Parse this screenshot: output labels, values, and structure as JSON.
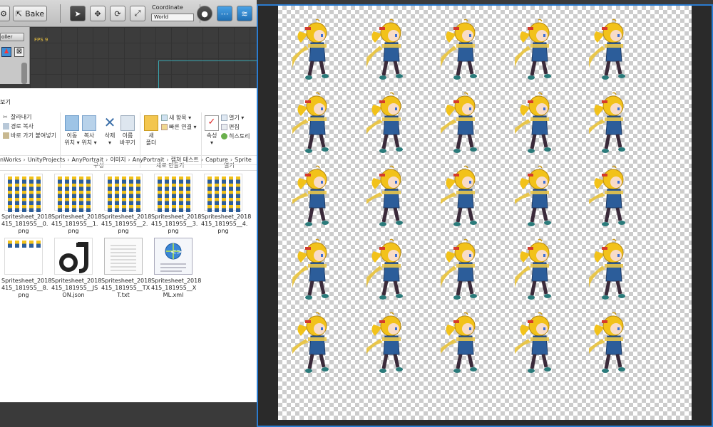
{
  "toolbar": {
    "bake_label": "Bake",
    "coordinate_label": "Coordinate",
    "coordinate_value": "World"
  },
  "left_panel": {
    "controller_label": "oller"
  },
  "viewport": {
    "fps_label": "FPS 9"
  },
  "explorer": {
    "title_fragment": "보기",
    "ribbon": {
      "cut": "잘라내기",
      "copy_path": "경로 복사",
      "paste_shortcut": "바로 가기 붙여넣기",
      "move_to": "이동\n위치 ▾",
      "copy_to": "복사\n위치 ▾",
      "delete": "삭제\n▾",
      "rename": "이름\n바꾸기",
      "new_folder": "새\n폴더",
      "new_item": "새 항목 ▾",
      "easy_access": "빠른 연결 ▾",
      "properties": "속성\n▾",
      "open": "열기 ▾",
      "edit": "편집",
      "history": "히스토리",
      "group_organize": "구성",
      "group_new": "새로 만들기",
      "group_open": "열기"
    },
    "breadcrumb": [
      "nWorks",
      "UnityProjects",
      "AnyPortrait",
      "이미지",
      "AnyPortrait",
      "캡쳐 테스트",
      "Capture",
      "Sprite"
    ],
    "files": [
      {
        "name": "Spritesheet_2018\n415_181955__0.\npng",
        "type": "sheet"
      },
      {
        "name": "Spritesheet_2018\n415_181955__1.\npng",
        "type": "sheet"
      },
      {
        "name": "Spritesheet_2018\n415_181955__2.\npng",
        "type": "sheet"
      },
      {
        "name": "Spritesheet_2018\n415_181955__3.\npng",
        "type": "sheet"
      },
      {
        "name": "Spritesheet_2018\n415_181955__4.\npng",
        "type": "sheet"
      },
      {
        "name": "Spritesheet_2018\n415_181955__8.\npng",
        "type": "sheet-small"
      },
      {
        "name": "Spritesheet_2018\n415_181955__JS\nON.json",
        "type": "json"
      },
      {
        "name": "Spritesheet_2018\n415_181955__TX\nT.txt",
        "type": "txt"
      },
      {
        "name": "Spritesheet_2018\n415_181955__X\nML.xml",
        "type": "xml"
      }
    ]
  },
  "preview": {
    "rows": 5,
    "cols": 5,
    "hair_color": "#f2c21a",
    "coat_color": "#2c5d9a",
    "scarf_color": "#e8c54a",
    "ribbon_color": "#d43a2a"
  }
}
